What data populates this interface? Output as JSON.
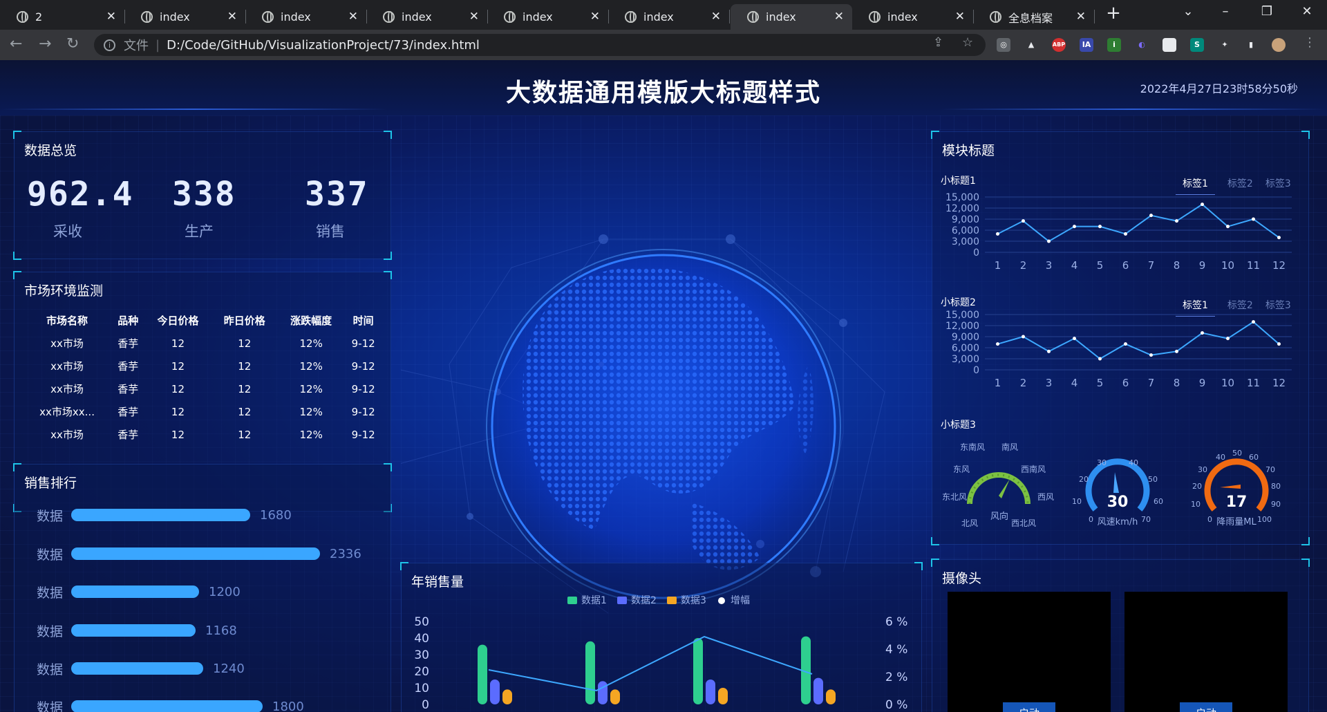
{
  "browser": {
    "tabs": [
      {
        "label": "2"
      },
      {
        "label": "index"
      },
      {
        "label": "index"
      },
      {
        "label": "index"
      },
      {
        "label": "index"
      },
      {
        "label": "index"
      },
      {
        "label": "index"
      },
      {
        "label": "index"
      },
      {
        "label": "全息档案"
      }
    ],
    "new_tab": "+",
    "address_prefix": "文件",
    "address": "D:/Code/GitHub/VisualizationProject/73/index.html"
  },
  "header": {
    "title": "大数据通用模版大标题样式",
    "clock": "2022年4月27日23时58分50秒"
  },
  "overview": {
    "title": "数据总览",
    "stats": [
      {
        "value": "962.4",
        "label": "采收"
      },
      {
        "value": "338",
        "label": "生产"
      },
      {
        "value": "337",
        "label": "销售"
      }
    ]
  },
  "market": {
    "title": "市场环境监测",
    "columns": [
      "市场名称",
      "品种",
      "今日价格",
      "昨日价格",
      "涨跌幅度",
      "时间"
    ],
    "rows": [
      [
        "xx市场",
        "香芋",
        "12",
        "12",
        "12%",
        "9-12"
      ],
      [
        "xx市场",
        "香芋",
        "12",
        "12",
        "12%",
        "9-12"
      ],
      [
        "xx市场",
        "香芋",
        "12",
        "12",
        "12%",
        "9-12"
      ],
      [
        "xx市场xx...",
        "香芋",
        "12",
        "12",
        "12%",
        "9-12"
      ],
      [
        "xx市场",
        "香芋",
        "12",
        "12",
        "12%",
        "9-12"
      ]
    ]
  },
  "ranking": {
    "title": "销售排行",
    "items": [
      {
        "label": "数据",
        "value": 1680
      },
      {
        "label": "数据",
        "value": 2336
      },
      {
        "label": "数据",
        "value": 1200
      },
      {
        "label": "数据",
        "value": 1168
      },
      {
        "label": "数据",
        "value": 1240
      },
      {
        "label": "数据",
        "value": 1800
      }
    ]
  },
  "module": {
    "title": "模块标题",
    "sub1": "小标题1",
    "sub2": "小标题2",
    "sub3": "小标题3",
    "tabs": [
      "标签1",
      "标签2",
      "标签3"
    ],
    "series1": [
      5000,
      8500,
      3000,
      7000,
      7000,
      5000,
      10000,
      8500,
      13000,
      7000,
      9000,
      4000
    ],
    "series2": [
      7000,
      9000,
      5000,
      8500,
      3000,
      7000,
      4000,
      5000,
      10000,
      8500,
      13000,
      7000
    ],
    "y_ticks": [
      "15,000",
      "12,000",
      "9,000",
      "6,000",
      "3,000",
      "0"
    ],
    "x_ticks": [
      "1",
      "2",
      "3",
      "4",
      "5",
      "6",
      "7",
      "8",
      "9",
      "10",
      "11",
      "12"
    ]
  },
  "gauges": {
    "wind_dir": {
      "label": "风向",
      "dirs": [
        "东南风",
        "南风",
        "东风",
        "西南风",
        "东北风",
        "西风",
        "北风",
        "西北风"
      ]
    },
    "wind_speed": {
      "label": "风速km/h",
      "value": "30",
      "ticks": [
        "0",
        "10",
        "20",
        "30",
        "40",
        "50",
        "60",
        "70"
      ]
    },
    "rain": {
      "label": "降雨量ML",
      "value": "17",
      "ticks": [
        "0",
        "10",
        "20",
        "30",
        "40",
        "50",
        "60",
        "70",
        "80",
        "90",
        "100"
      ]
    }
  },
  "yearly": {
    "title": "年销售量",
    "legend": [
      "数据1",
      "数据2",
      "数据3",
      "增幅"
    ],
    "y_left": [
      "50",
      "40",
      "30",
      "20",
      "10",
      "0"
    ],
    "y_right": [
      "6 %",
      "4 %",
      "2 %",
      "0 %"
    ]
  },
  "camera": {
    "title": "摄像头",
    "button": "启动"
  },
  "chart_data": [
    {
      "type": "line",
      "title": "小标题1",
      "x": [
        "1",
        "2",
        "3",
        "4",
        "5",
        "6",
        "7",
        "8",
        "9",
        "10",
        "11",
        "12"
      ],
      "values": [
        5000,
        8500,
        3000,
        7000,
        7000,
        5000,
        10000,
        8500,
        13000,
        7000,
        9000,
        4000
      ],
      "ylim": [
        0,
        15000
      ]
    },
    {
      "type": "line",
      "title": "小标题2",
      "x": [
        "1",
        "2",
        "3",
        "4",
        "5",
        "6",
        "7",
        "8",
        "9",
        "10",
        "11",
        "12"
      ],
      "values": [
        7000,
        9000,
        5000,
        8500,
        3000,
        7000,
        4000,
        5000,
        10000,
        8500,
        13000,
        7000
      ],
      "ylim": [
        0,
        15000
      ]
    },
    {
      "type": "bar",
      "title": "销售排行",
      "categories": [
        "数据",
        "数据",
        "数据",
        "数据",
        "数据",
        "数据"
      ],
      "values": [
        1680,
        2336,
        1200,
        1168,
        1240,
        1800
      ]
    },
    {
      "type": "bar",
      "title": "年销售量",
      "series": [
        {
          "name": "数据1",
          "values": [
            36,
            38,
            40,
            41
          ]
        },
        {
          "name": "数据2",
          "values": [
            15,
            14,
            15,
            16
          ]
        },
        {
          "name": "数据3",
          "values": [
            9,
            9,
            10,
            9
          ]
        },
        {
          "name": "增幅",
          "values": [
            2.5,
            1,
            4.9,
            2.2
          ]
        }
      ],
      "ylim": [
        0,
        50
      ]
    }
  ]
}
